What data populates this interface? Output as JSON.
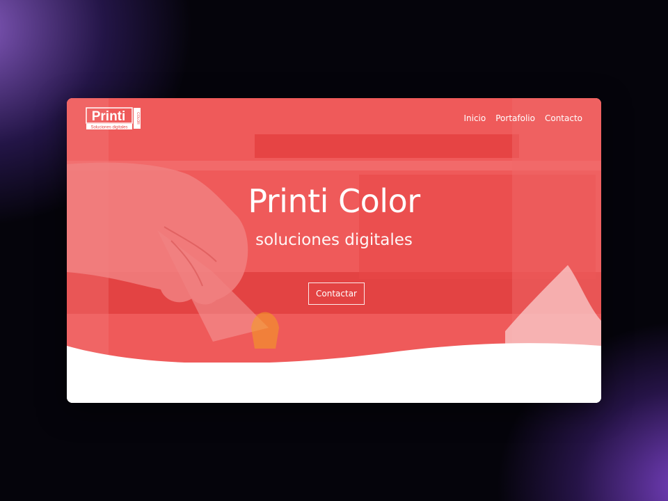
{
  "logo": {
    "name": "Printi",
    "tagline": "Soluciones digitales",
    "side": "COLOR"
  },
  "nav": {
    "items": [
      "Inicio",
      "Portafolio",
      "Contacto"
    ]
  },
  "hero": {
    "title": "Printi Color",
    "subtitle": "soluciones digitales",
    "cta_label": "Contactar"
  },
  "colors": {
    "hero_red": "#ee4a4a",
    "card_white": "#ffffff"
  }
}
